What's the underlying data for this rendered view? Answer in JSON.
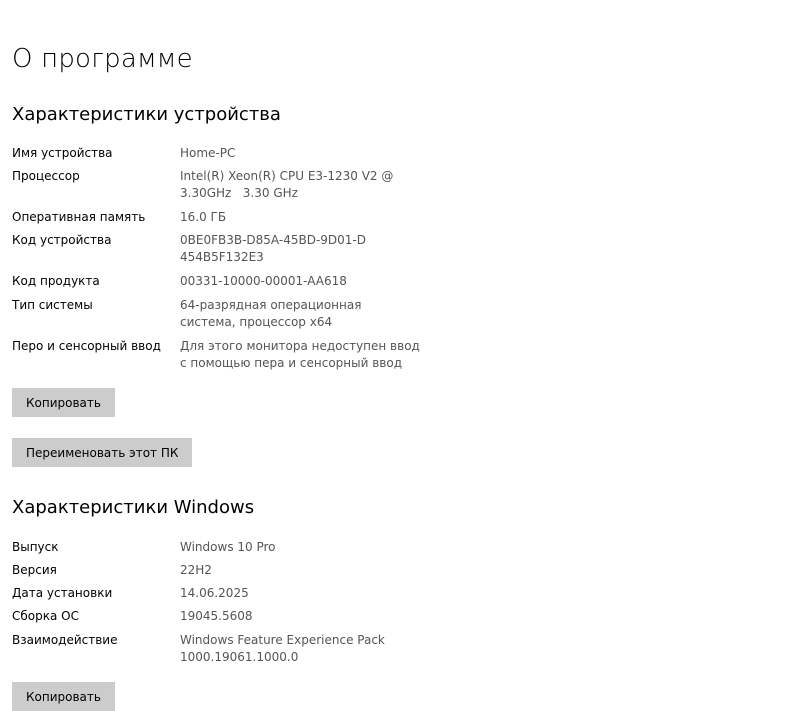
{
  "page": {
    "title": "О программе"
  },
  "device": {
    "title": "Характеристики устройства",
    "rows": [
      {
        "label": "Имя устройства",
        "value": "Home-PC"
      },
      {
        "label": "Процессор",
        "value": "Intel(R) Xeon(R) CPU E3-1230 V2 @ 3.30GHz   3.30 GHz"
      },
      {
        "label": "Оперативная память",
        "value": "16.0 ГБ"
      },
      {
        "label": "Код устройства",
        "value": "0BE0FB3B-D85A-45BD-9D01-D454B5F132E3"
      },
      {
        "label": "Код продукта",
        "value": "00331-10000-00001-AA618"
      },
      {
        "label": "Тип системы",
        "value": "64-разрядная операционная система, процессор x64"
      },
      {
        "label": "Перо и сенсорный ввод",
        "value": "Для этого монитора недоступен ввод с помощью пера и сенсорный ввод"
      }
    ],
    "copy_label": "Копировать",
    "rename_label": "Переименовать этот ПК"
  },
  "windows": {
    "title": "Характеристики Windows",
    "rows": [
      {
        "label": "Выпуск",
        "value": "Windows 10 Pro"
      },
      {
        "label": "Версия",
        "value": "22H2"
      },
      {
        "label": "Дата установки",
        "value": "14.06.2025"
      },
      {
        "label": "Сборка ОС",
        "value": "19045.5608"
      },
      {
        "label": "Взаимодействие",
        "value": "Windows Feature Experience Pack 1000.19061.1000.0"
      }
    ],
    "copy_label": "Копировать"
  }
}
